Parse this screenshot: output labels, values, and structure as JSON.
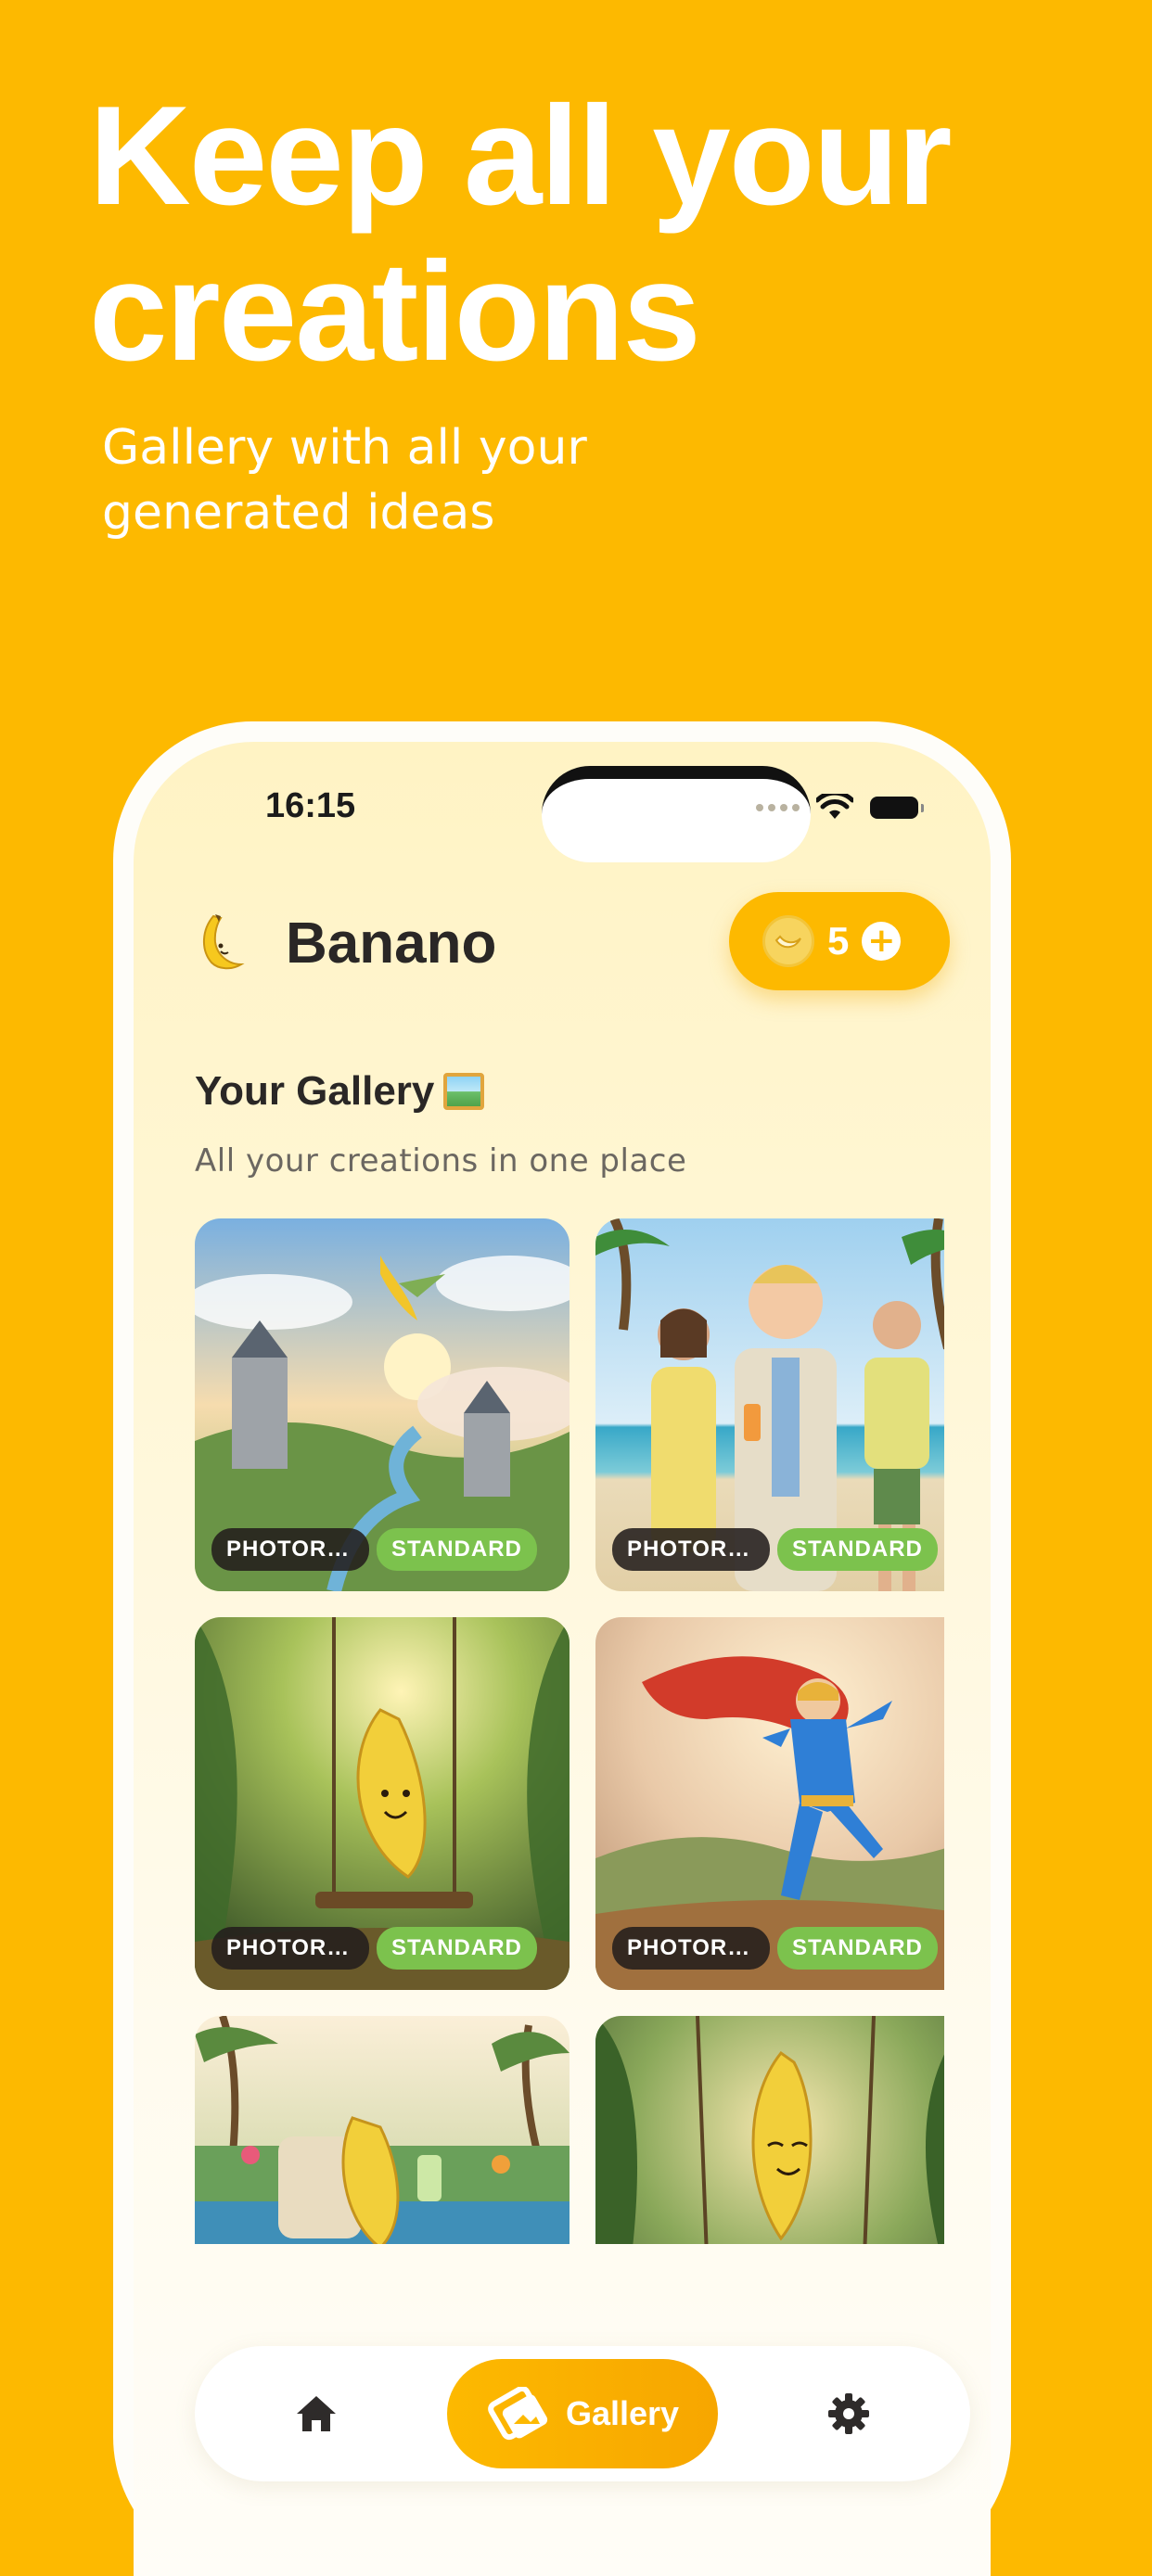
{
  "promo": {
    "headline": "Keep all your creations",
    "subheadline": "Gallery with all your generated ideas"
  },
  "status_bar": {
    "time": "16:15"
  },
  "app": {
    "name": "Banano",
    "credits": "5",
    "plus_label": "+"
  },
  "gallery": {
    "title": "Your Gallery",
    "subtitle": "All your creations in one place",
    "items": [
      {
        "scene": "Fantasy kingdom with flying banana",
        "style_tag": "PHOTOREAL...",
        "quality_tag": "STANDARD"
      },
      {
        "scene": "Beach party with cocktails",
        "style_tag": "PHOTOREAL...",
        "quality_tag": "STANDARD"
      },
      {
        "scene": "Banana on a jungle swing",
        "style_tag": "PHOTOREAL...",
        "quality_tag": "STANDARD"
      },
      {
        "scene": "Superhero in red cape",
        "style_tag": "PHOTOREAL...",
        "quality_tag": "STANDARD"
      },
      {
        "scene": "Banana relaxing by the pool",
        "style_tag": "",
        "quality_tag": ""
      },
      {
        "scene": "Banana on a swing in the jungle",
        "style_tag": "",
        "quality_tag": ""
      }
    ]
  },
  "nav": {
    "home_icon": "home-icon",
    "gallery_label": "Gallery",
    "settings_icon": "gear-icon"
  },
  "colors": {
    "brand_yellow": "#FDB900",
    "tag_green": "#7cc24d",
    "tag_dark": "#231e1c"
  }
}
